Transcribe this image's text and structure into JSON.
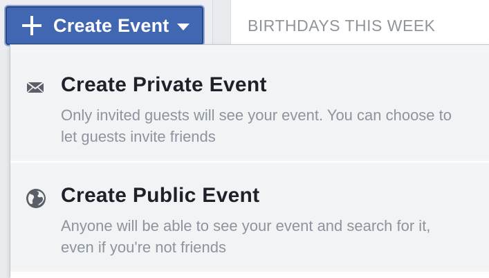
{
  "toolbar": {
    "create_label": "Create Event"
  },
  "birthdays": {
    "title": "BIRTHDAYS THIS WEEK"
  },
  "menu": {
    "items": [
      {
        "icon": "envelope-icon",
        "title": "Create Private Event",
        "description": "Only invited guests will see your event. You can choose to let guests invite friends"
      },
      {
        "icon": "globe-icon",
        "title": "Create Public Event",
        "description": "Anyone will be able to see your event and search for it, even if you're not friends"
      }
    ]
  },
  "colors": {
    "primary_button": "#4267b2",
    "title_text": "#1d2129",
    "muted_text": "#8d949e",
    "header_text": "#90949c",
    "background": "#e9ebee"
  }
}
